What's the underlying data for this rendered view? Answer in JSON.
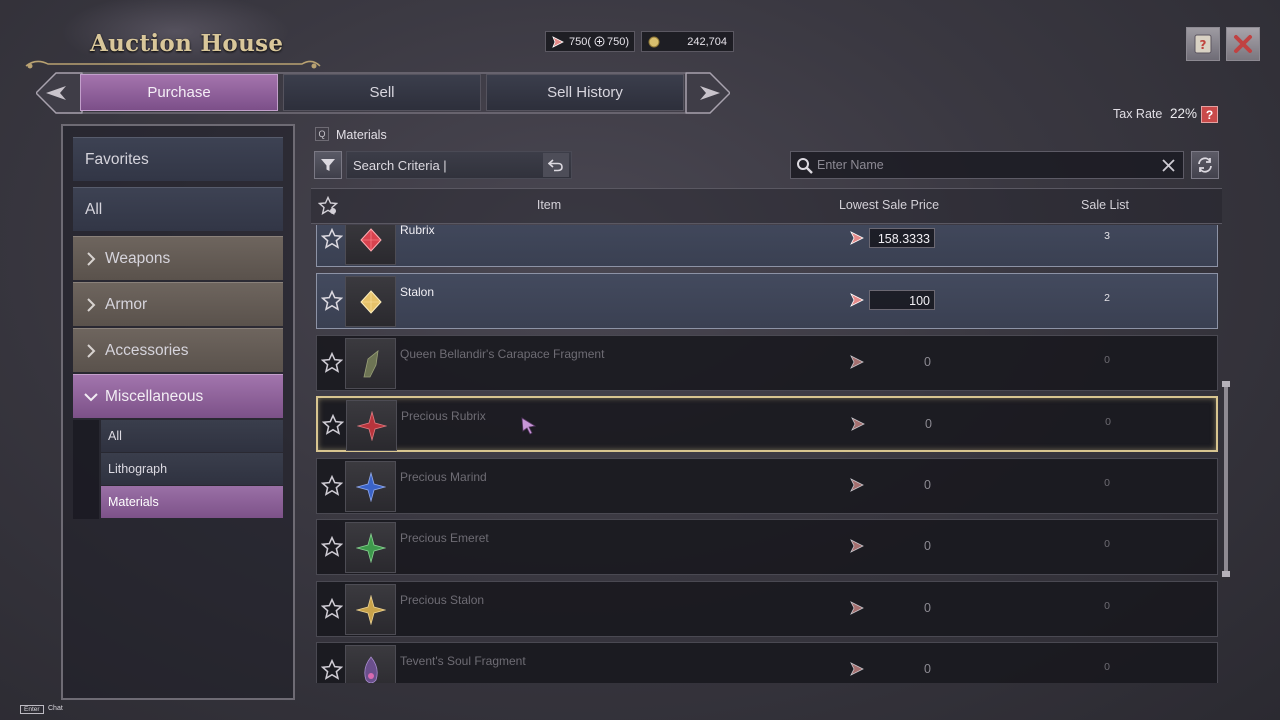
{
  "window": {
    "title": "Auction House"
  },
  "currency": {
    "tickets": "750(",
    "tickets_extra": "750)",
    "gold": "242,704"
  },
  "tabs": [
    {
      "label": "Purchase",
      "active": true
    },
    {
      "label": "Sell",
      "active": false
    },
    {
      "label": "Sell History",
      "active": false
    }
  ],
  "tax": {
    "label": "Tax Rate",
    "value": "22%",
    "help": "?"
  },
  "sidebar": {
    "favorites": "Favorites",
    "all": "All",
    "categories": [
      {
        "label": "Weapons",
        "expanded": false
      },
      {
        "label": "Armor",
        "expanded": false
      },
      {
        "label": "Accessories",
        "expanded": false
      },
      {
        "label": "Miscellaneous",
        "expanded": true
      }
    ],
    "sub_items": [
      {
        "label": "All",
        "active": false
      },
      {
        "label": "Lithograph",
        "active": false
      },
      {
        "label": "Materials",
        "active": true
      }
    ]
  },
  "breadcrumb": {
    "key": "Q",
    "label": "Materials"
  },
  "filter": {
    "criteria_label": "Search Criteria  |",
    "name_placeholder": "Enter Name"
  },
  "table": {
    "columns": {
      "item": "Item",
      "price": "Lowest Sale Price",
      "count": "Sale List"
    },
    "rows": [
      {
        "name": "Rubrix",
        "price": "158.3333",
        "count": "3",
        "available": true,
        "gem_color": "#d8434f"
      },
      {
        "name": "Stalon",
        "price": "100",
        "count": "2",
        "available": true,
        "gem_color": "#e6c26a"
      },
      {
        "name": "Queen Bellandir's Carapace Fragment",
        "price": "0",
        "count": "0",
        "available": false,
        "gem_color": "#7c8a5e"
      },
      {
        "name": "Precious Rubrix",
        "price": "0",
        "count": "0",
        "available": false,
        "selected": true,
        "gem_color": "#b8343c"
      },
      {
        "name": "Precious Marind",
        "price": "0",
        "count": "0",
        "available": false,
        "gem_color": "#3a63c8"
      },
      {
        "name": "Precious Emeret",
        "price": "0",
        "count": "0",
        "available": false,
        "gem_color": "#3e9a4c"
      },
      {
        "name": "Precious Stalon",
        "price": "0",
        "count": "0",
        "available": false,
        "gem_color": "#c8a24a"
      },
      {
        "name": "Tevent's Soul Fragment",
        "price": "0",
        "count": "0",
        "available": false,
        "gem_color": "#8e6ab0"
      }
    ]
  },
  "hint": {
    "key": "Enter",
    "label": "Chat"
  },
  "colors": {
    "accent_purple": "#8e62a0",
    "gold_text": "#d9c79a",
    "selection_border": "#d8c590"
  }
}
